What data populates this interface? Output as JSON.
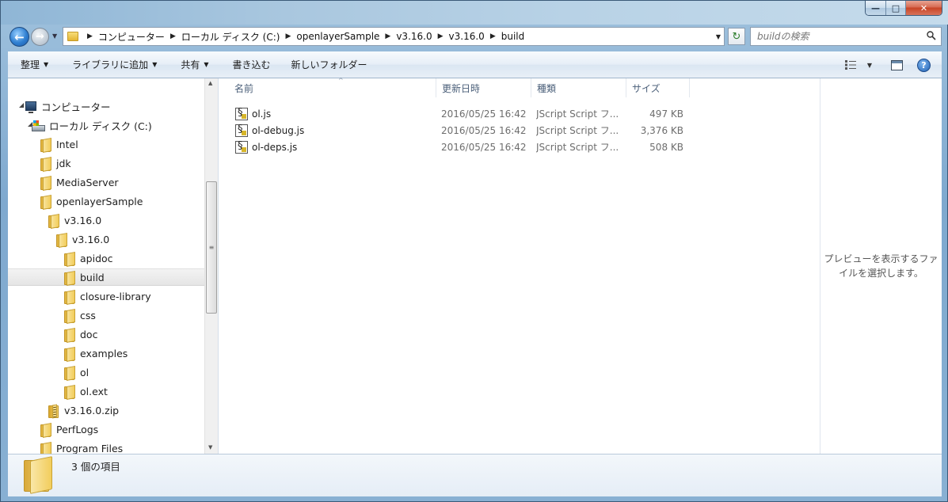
{
  "window": {
    "caption_min": "—",
    "caption_max": "□",
    "caption_close": "✕"
  },
  "address": {
    "crumbs": [
      "コンピューター",
      "ローカル ディスク (C:)",
      "openlayerSample",
      "v3.16.0",
      "v3.16.0",
      "build"
    ]
  },
  "search": {
    "placeholder": "buildの検索"
  },
  "toolbar": {
    "organize": "整理",
    "add_to_library": "ライブラリに追加",
    "share": "共有",
    "burn": "書き込む",
    "new_folder": "新しいフォルダー"
  },
  "tree": {
    "computer": "コンピューター",
    "local_disk": "ローカル ディスク (C:)",
    "intel": "Intel",
    "jdk": "jdk",
    "mediaserver": "MediaServer",
    "openlayersample": "openlayerSample",
    "v3160_a": "v3.16.0",
    "v3160_b": "v3.16.0",
    "apidoc": "apidoc",
    "build": "build",
    "closure_library": "closure-library",
    "css": "css",
    "doc": "doc",
    "examples": "examples",
    "ol": "ol",
    "ol_ext": "ol.ext",
    "zip": "v3.16.0.zip",
    "perflogs": "PerfLogs",
    "program_files": "Program Files"
  },
  "columns": {
    "name": "名前",
    "modified": "更新日時",
    "type": "種類",
    "size": "サイズ"
  },
  "files": [
    {
      "name": "ol.js",
      "modified": "2016/05/25 16:42",
      "type": "JScript Script フ...",
      "size": "497 KB"
    },
    {
      "name": "ol-debug.js",
      "modified": "2016/05/25 16:42",
      "type": "JScript Script フ...",
      "size": "3,376 KB"
    },
    {
      "name": "ol-deps.js",
      "modified": "2016/05/25 16:42",
      "type": "JScript Script フ...",
      "size": "508 KB"
    }
  ],
  "preview": {
    "message": "プレビューを表示するファイルを選択します。"
  },
  "status": {
    "item_count": "3 個の項目"
  }
}
